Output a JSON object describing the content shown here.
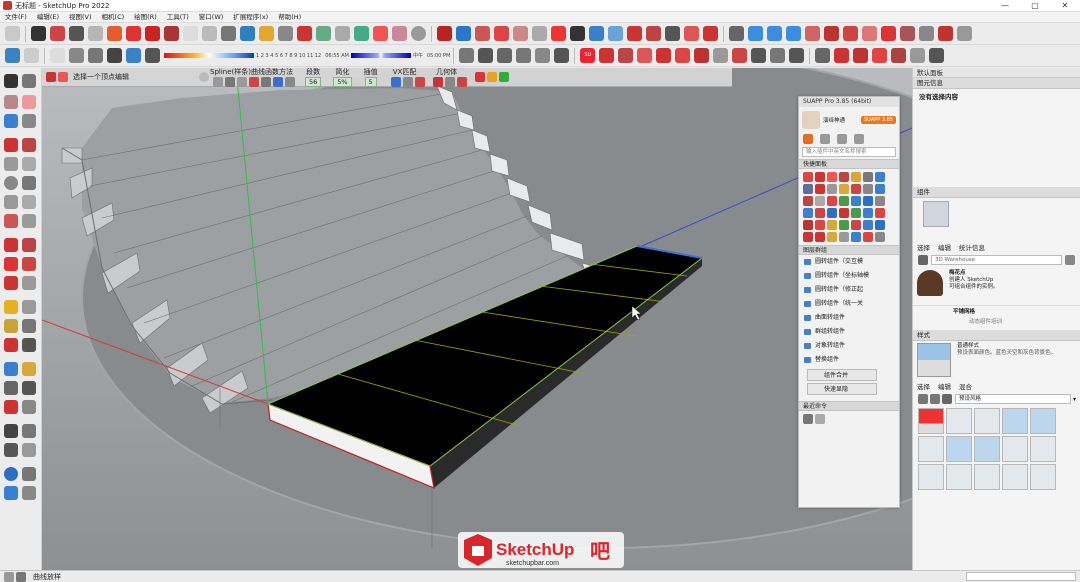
{
  "window": {
    "title": "无标题 - SketchUp Pro 2022",
    "controls": [
      "—",
      "▢",
      "✕"
    ]
  },
  "menu": [
    "文件(F)",
    "编辑(E)",
    "视图(V)",
    "相机(C)",
    "绘图(R)",
    "工具(T)",
    "窗口(W)",
    "扩展程序(x)",
    "帮助(H)"
  ],
  "toolbar": {
    "shadow_ticks": "1 2 3 4 5 6 7 8 9 10 11 12",
    "time_start": "06:55 AM",
    "time_mid": "中午",
    "time_end": "05:00 PM"
  },
  "command_bar": {
    "hint": "选择一个顶点编辑",
    "spline_label": "Spline(样条)曲线函数方法",
    "segments_label": "段数",
    "segments_value": "56",
    "simplify_label": "简化",
    "simplify_value": "5%",
    "interp_label": "插值",
    "interp_value": "5",
    "vx_label": "VX匹配",
    "geom_label": "几何体"
  },
  "suapp": {
    "title": "SUAPP Pro 3.85 (64bit)",
    "badge": "SUAPP 3.85",
    "user_label": "演绎神通",
    "search_placeholder": "输入插件中英文名称搜索",
    "quick_panel": "快捷面板",
    "group_panel": "图层群组",
    "items": [
      "圆转组件（交互模",
      "圆转组件（坐标轴模",
      "圆转组件（修正起",
      "圆转组件（统一关",
      "曲面转组件",
      "群组转组件",
      "对象转组件",
      "替换组件"
    ],
    "merge_btn": "组件合并",
    "quick_btn": "快速显隐",
    "recent": "最近命令"
  },
  "right_panel": {
    "tray_title": "默认面板",
    "entity_info": "图元信息",
    "no_selection": "没有选择内容",
    "components": "组件",
    "comp_tabs": [
      "选择",
      "编辑",
      "统计信息"
    ],
    "warehouse": "3D Warehouse",
    "comp_item_title": "梅花点",
    "comp_item_desc": "创建人 SketchUp",
    "comp_item_desc2": "可组合组件的实例。",
    "comp_item2": "平铺网格",
    "comp_item3": "动态组件培训",
    "styles": "样式",
    "style_name": "普通样式",
    "style_desc": "预设表面颜色。蓝色天空和灰色背景色。",
    "style_tabs": [
      "选择",
      "编辑",
      "混合"
    ],
    "style_dropdown": "预设风格"
  },
  "status": {
    "text": "曲线放样"
  },
  "watermark": {
    "brand": "SketchUp",
    "brand_suffix": "吧",
    "url": "sketchupbar.com"
  },
  "colors": {
    "accent": "#c6372f",
    "selection": "#3f6fd8",
    "face": "#000000",
    "edge_green": "#7ec850",
    "suapp_orange": "#ea7a1e"
  }
}
